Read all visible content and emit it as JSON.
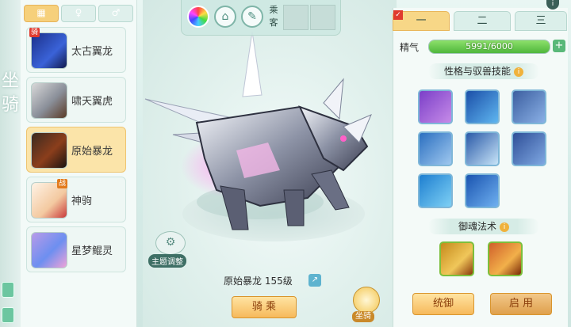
{
  "left_rail": {
    "vertical_text": [
      "坐",
      "骑"
    ]
  },
  "list_tabs": [
    {
      "icon": "grid-icon",
      "active": true
    },
    {
      "icon": "figure-icon",
      "active": false
    },
    {
      "icon": "figure-outline-icon",
      "active": false
    }
  ],
  "mounts": [
    {
      "name": "太古翼龙",
      "badge": "骑",
      "selected": false
    },
    {
      "name": "啸天翼虎",
      "badge": "",
      "selected": false
    },
    {
      "name": "原始暴龙",
      "badge": "",
      "selected": true
    },
    {
      "name": "神驹",
      "badge": "战",
      "selected": false
    },
    {
      "name": "星梦鲲灵",
      "badge": "",
      "selected": false
    }
  ],
  "toolbar": {
    "buttons": [
      "color-wheel-icon",
      "house-icon",
      "brush-icon"
    ],
    "ride_label": "乘客"
  },
  "stage": {
    "theme_button": "主题调整",
    "mount_title": "原始暴龙 155级",
    "ride_button": "骑 乘",
    "mount_badge": "坐骑"
  },
  "right": {
    "tabs": [
      "一",
      "二",
      "三"
    ],
    "active_tab": 0,
    "essence_label": "精气",
    "essence_value": "5991/6000",
    "essence_fraction": 0.9985,
    "traits_title": "性格与驭兽技能",
    "skills": [
      "rat-skill-icon",
      "blue-dragon-skill-icon",
      "wolf-skill-icon",
      "shield-skill-icon",
      "tiger-skill-icon",
      "beast-run-skill-icon",
      "paw-skill-icon",
      "butterfly-skill-icon"
    ],
    "soul_title": "御魂法术",
    "soul_skills": [
      "lion-claw-icon",
      "lion-roar-icon"
    ],
    "btn_command": "统御",
    "btn_enable": "启 用"
  }
}
